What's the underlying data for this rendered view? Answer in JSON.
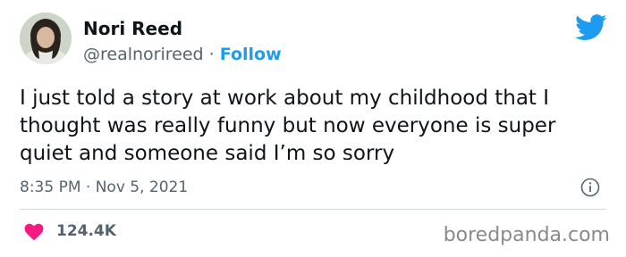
{
  "author": {
    "display_name": "Nori Reed",
    "handle": "@realnorireed",
    "separator": "·",
    "follow_label": "Follow"
  },
  "tweet": {
    "text": "I just told a story at work about my childhood that I thought was really funny but now everyone is super quiet and someone said I’m so sorry",
    "timestamp": "8:35 PM · Nov 5, 2021"
  },
  "engagement": {
    "likes": "124.4K"
  },
  "watermark": "boredpanda.com",
  "icons": {
    "brand": "twitter-bird-icon",
    "info": "info-icon",
    "like": "heart-icon"
  },
  "colors": {
    "link": "#1d9bf0",
    "twitter_blue": "#1d9bf0",
    "secondary_text": "#536471",
    "like": "#f91880",
    "divider": "#cfd9de"
  }
}
